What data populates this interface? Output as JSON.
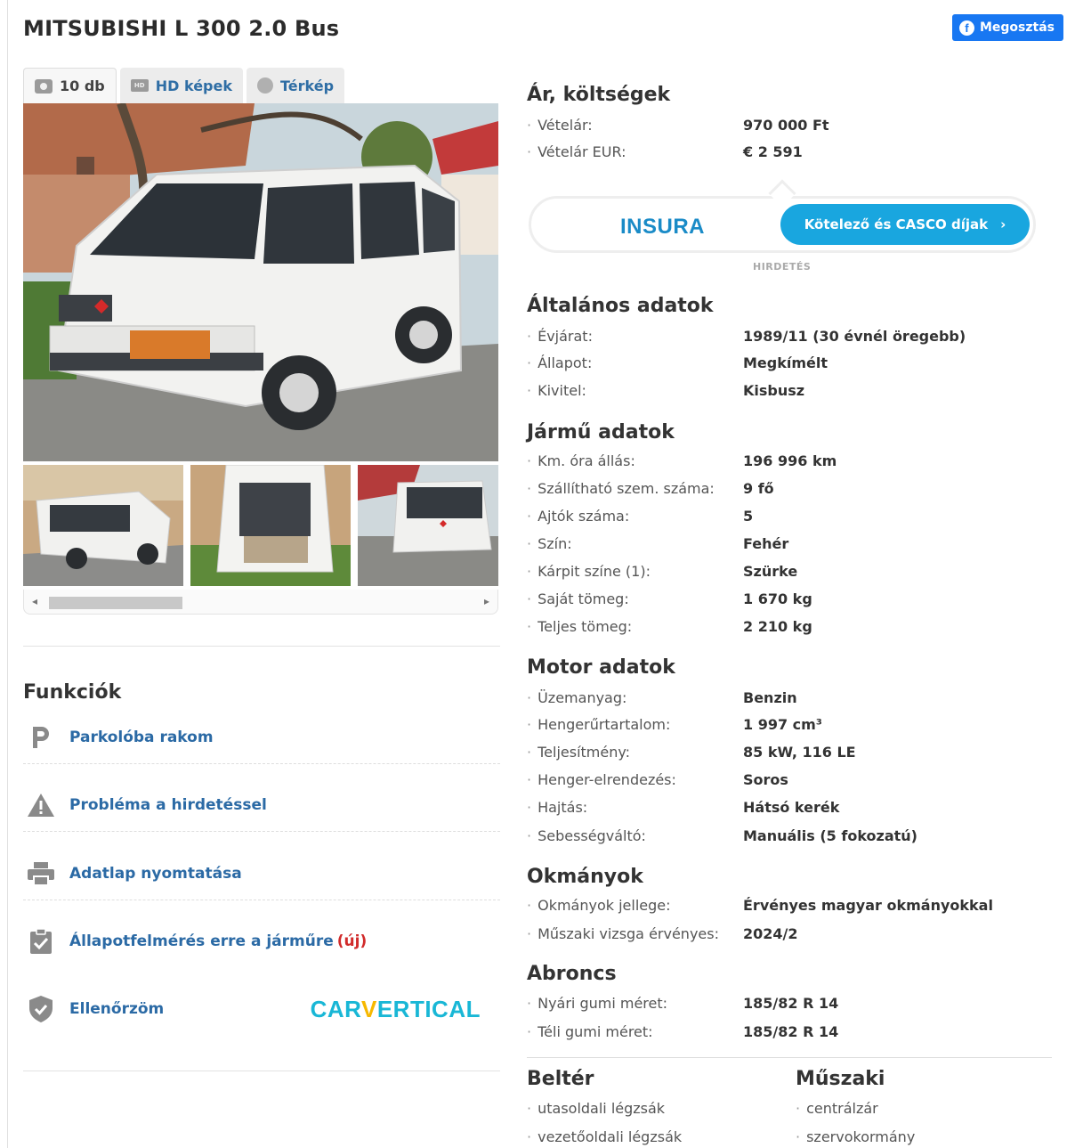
{
  "title": "MITSUBISHI L 300 2.0 Bus",
  "share_label": "Megosztás",
  "tabs": [
    {
      "label": "10 db",
      "icon": "camera-icon"
    },
    {
      "label": "HD képek",
      "icon": "hd-icon"
    },
    {
      "label": "Térkép",
      "icon": "map-icon"
    }
  ],
  "price": {
    "heading": "Ár, költségek",
    "rows": [
      {
        "label": "Vételár:",
        "value": "970 000 Ft"
      },
      {
        "label": "Vételár EUR:",
        "value": "€ 2 591"
      }
    ]
  },
  "ad": {
    "logo": "INSURA",
    "button": "Kötelező és CASCO díjak",
    "tag": "HIRDETÉS"
  },
  "general": {
    "heading": "Általános adatok",
    "rows": [
      {
        "label": "Évjárat:",
        "value": "1989/11 (30 évnél öregebb)"
      },
      {
        "label": "Állapot:",
        "value": "Megkímélt"
      },
      {
        "label": "Kivitel:",
        "value": "Kisbusz"
      }
    ]
  },
  "vehicle": {
    "heading": "Jármű adatok",
    "rows": [
      {
        "label": "Km. óra állás:",
        "value": "196 996 km"
      },
      {
        "label": "Szállítható szem. száma:",
        "value": "9 fő"
      },
      {
        "label": "Ajtók száma:",
        "value": "5"
      },
      {
        "label": "Szín:",
        "value": "Fehér"
      },
      {
        "label": "Kárpit színe (1):",
        "value": "Szürke"
      },
      {
        "label": "Saját tömeg:",
        "value": "1 670 kg"
      },
      {
        "label": "Teljes tömeg:",
        "value": "2 210 kg"
      }
    ]
  },
  "engine": {
    "heading": "Motor adatok",
    "rows": [
      {
        "label": "Üzemanyag:",
        "value": "Benzin"
      },
      {
        "label": "Hengerűrtartalom:",
        "value": "1 997 cm³"
      },
      {
        "label": "Teljesítmény:",
        "value": "85 kW, 116 LE"
      },
      {
        "label": "Henger-elrendezés:",
        "value": "Soros"
      },
      {
        "label": "Hajtás:",
        "value": "Hátsó kerék"
      },
      {
        "label": "Sebességváltó:",
        "value": "Manuális (5 fokozatú)"
      }
    ]
  },
  "documents": {
    "heading": "Okmányok",
    "rows": [
      {
        "label": "Okmányok jellege:",
        "value": "Érvényes magyar okmányokkal"
      },
      {
        "label": "Műszaki vizsga érvényes:",
        "value": "2024/2"
      }
    ]
  },
  "tires": {
    "heading": "Abroncs",
    "rows": [
      {
        "label": "Nyári gumi méret:",
        "value": "185/82 R 14"
      },
      {
        "label": "Téli gumi méret:",
        "value": "185/82 R 14"
      }
    ]
  },
  "interior": {
    "heading": "Beltér",
    "items": [
      "utasoldali légzsák",
      "vezetőoldali légzsák"
    ]
  },
  "technical": {
    "heading": "Műszaki",
    "items": [
      "centrálzár",
      "szervokormány"
    ]
  },
  "functions": {
    "heading": "Funkciók",
    "items": [
      {
        "label": "Parkolóba rakom",
        "icon": "parking-icon"
      },
      {
        "label": "Probléma a hirdetéssel",
        "icon": "warning-icon"
      },
      {
        "label": "Adatlap nyomtatása",
        "icon": "printer-icon"
      },
      {
        "label": "Állapotfelmérés erre a járműre",
        "badge": "(új)",
        "icon": "clipboard-check-icon"
      },
      {
        "label": "Ellenőrzöm",
        "icon": "shield-check-icon"
      }
    ],
    "carvertical": {
      "before": "CAR",
      "v": "V",
      "after": "ERTICAL"
    }
  },
  "colors": {
    "accent": "#2b6aa5",
    "share": "#1877f2",
    "insura": "#19a6df",
    "new_badge": "#d12b2b"
  }
}
